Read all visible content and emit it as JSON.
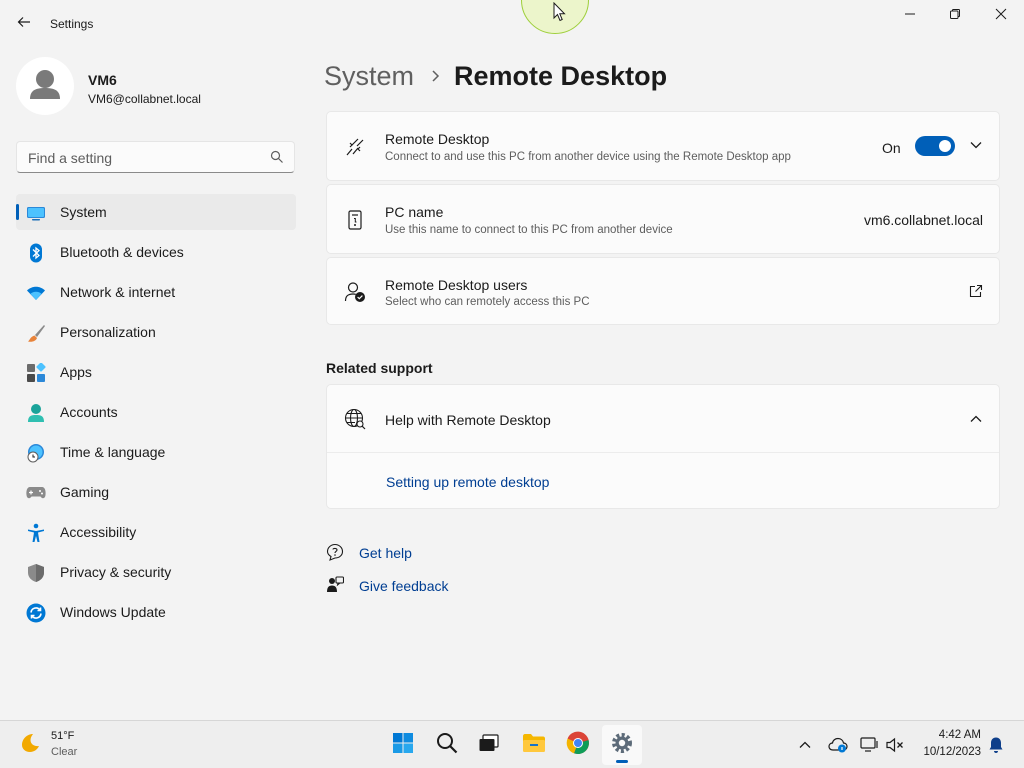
{
  "window": {
    "title": "Settings",
    "back_icon": "arrow-left-icon",
    "minimize_icon": "minimize-icon",
    "maximize_icon": "restore-icon",
    "close_icon": "close-icon"
  },
  "profile": {
    "name": "VM6",
    "email": "VM6@collabnet.local"
  },
  "search": {
    "placeholder": "Find a setting"
  },
  "sidebar": {
    "items": [
      {
        "label": "System",
        "icon": "system-icon",
        "selected": true
      },
      {
        "label": "Bluetooth & devices",
        "icon": "bluetooth-icon"
      },
      {
        "label": "Network & internet",
        "icon": "wifi-icon"
      },
      {
        "label": "Personalization",
        "icon": "brush-icon"
      },
      {
        "label": "Apps",
        "icon": "apps-icon"
      },
      {
        "label": "Accounts",
        "icon": "accounts-icon"
      },
      {
        "label": "Time & language",
        "icon": "time-language-icon"
      },
      {
        "label": "Gaming",
        "icon": "gamepad-icon"
      },
      {
        "label": "Accessibility",
        "icon": "accessibility-icon"
      },
      {
        "label": "Privacy & security",
        "icon": "shield-icon"
      },
      {
        "label": "Windows Update",
        "icon": "update-icon"
      }
    ]
  },
  "breadcrumb": {
    "parent": "System",
    "current": "Remote Desktop"
  },
  "settings": {
    "remote_desktop": {
      "title": "Remote Desktop",
      "description": "Connect to and use this PC from another device using the Remote Desktop app",
      "toggle_label": "On",
      "toggle_on": true
    },
    "pc_name": {
      "title": "PC name",
      "description": "Use this name to connect to this PC from another device",
      "value": "vm6.collabnet.local"
    },
    "users": {
      "title": "Remote Desktop users",
      "description": "Select who can remotely access this PC"
    }
  },
  "related_support": {
    "heading": "Related support",
    "help_title": "Help with Remote Desktop",
    "links": [
      "Setting up remote desktop"
    ]
  },
  "footer": {
    "get_help": "Get help",
    "give_feedback": "Give feedback"
  },
  "taskbar": {
    "weather": {
      "temp": "51°F",
      "condition": "Clear"
    },
    "apps": [
      "start-icon",
      "search-icon",
      "task-view-icon",
      "file-explorer-icon",
      "chrome-icon",
      "settings-icon"
    ],
    "clock": {
      "time": "4:42 AM",
      "date": "10/12/2023"
    }
  },
  "colors": {
    "accent": "#005fb8",
    "link": "#003e92",
    "background": "#f3f3f3",
    "card": "#fbfbfb"
  }
}
